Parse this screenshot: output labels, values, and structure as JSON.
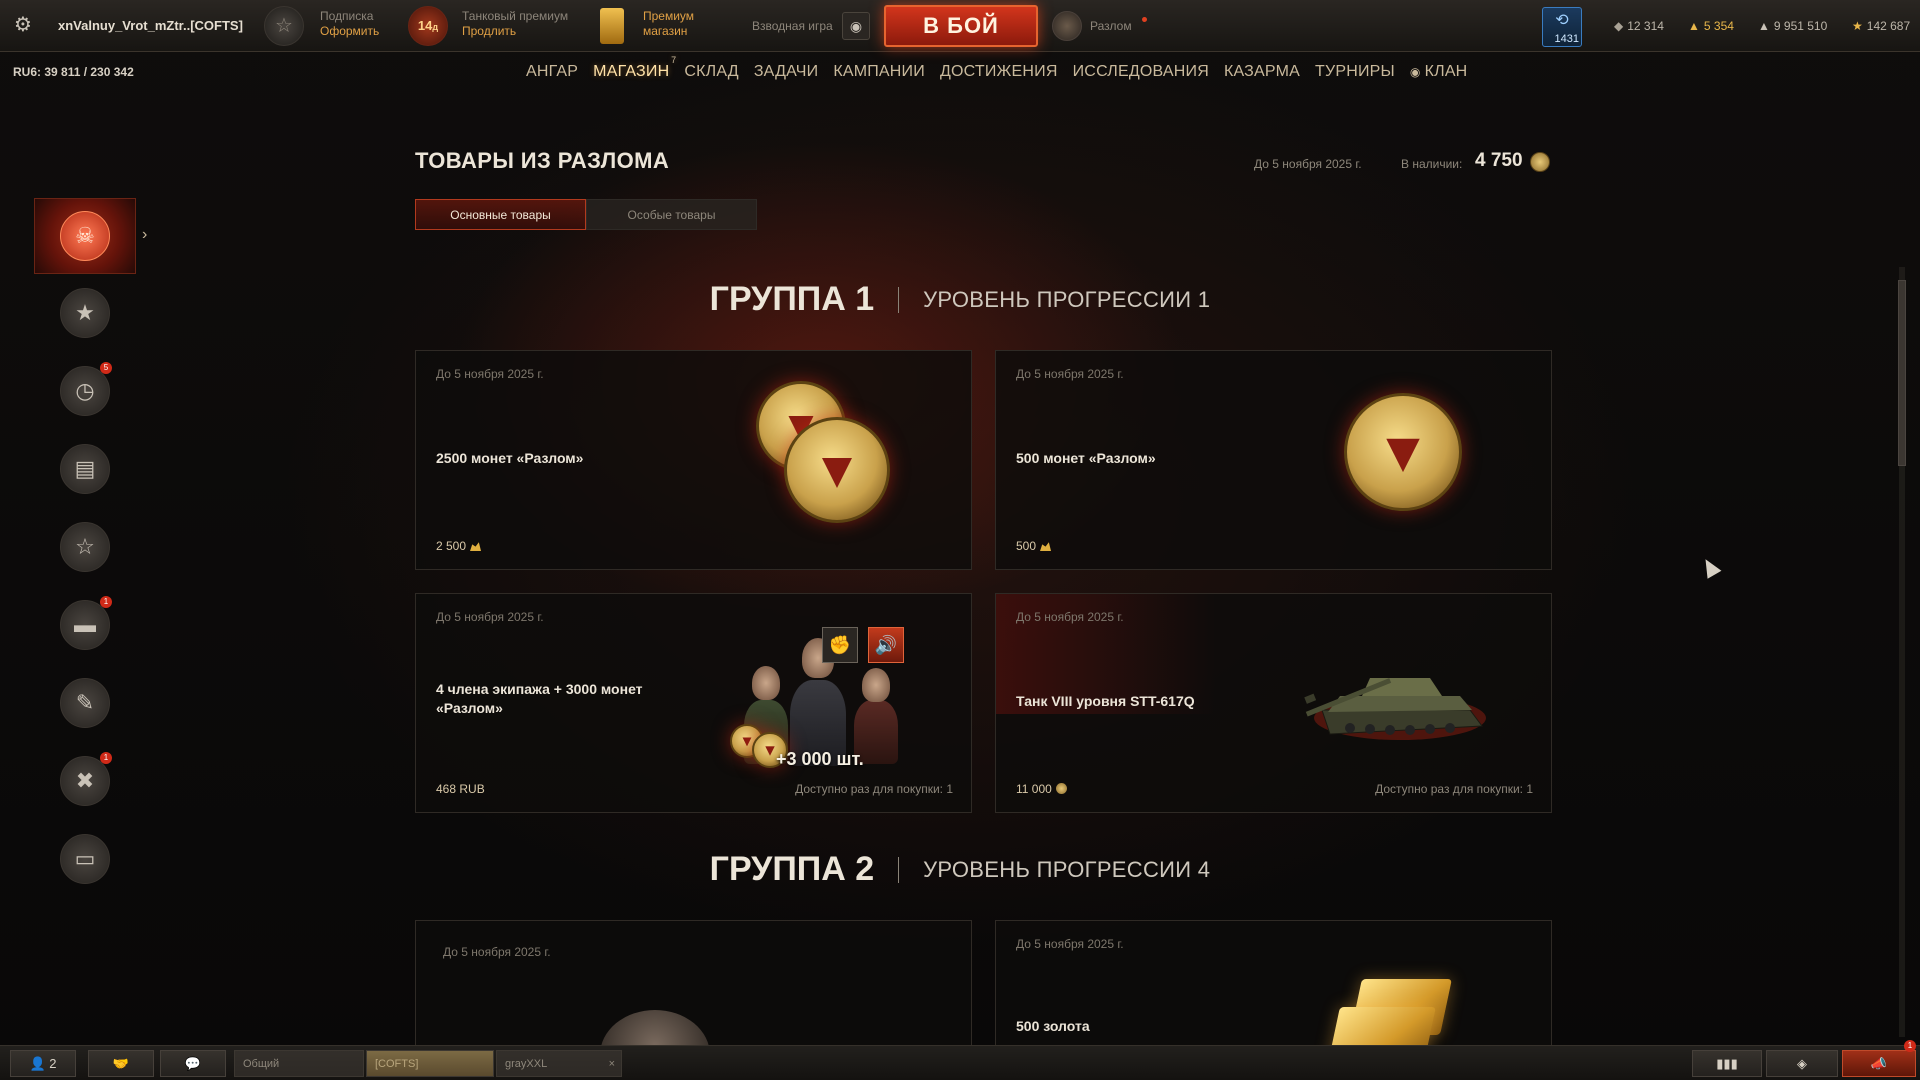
{
  "topbar": {
    "nickname": "xnValnuy_Vrot_mZtr..[COFTS]",
    "subscription": {
      "label": "Подписка",
      "action": "Оформить"
    },
    "tank_premium": {
      "days": "14",
      "days_unit": "д",
      "label": "Танковый премиум",
      "action": "Продлить"
    },
    "premium_shop": {
      "line1": "Премиум",
      "line2": "магазин"
    },
    "platoon_label": "Взводная игра",
    "battle_button": "В БОЙ",
    "mode_label": "Разлом",
    "level_badge": "1431",
    "currencies": [
      {
        "icon": "bond-icon",
        "value": "12 314"
      },
      {
        "icon": "gold-icon",
        "value": "5 354"
      },
      {
        "icon": "credits-icon",
        "value": "9 951 510"
      },
      {
        "icon": "free-xp-icon",
        "value": "142 687"
      }
    ]
  },
  "ru_line": "RU6: 39 811  /  230 342",
  "nav": {
    "items": [
      {
        "label": "АНГАР"
      },
      {
        "label": "МАГАЗИН",
        "badge": "7",
        "active": true
      },
      {
        "label": "СКЛАД"
      },
      {
        "label": "ЗАДАЧИ"
      },
      {
        "label": "КАМПАНИИ"
      },
      {
        "label": "ДОСТИЖЕНИЯ"
      },
      {
        "label": "ИССЛЕДОВАНИЯ"
      },
      {
        "label": "КАЗАРМА"
      },
      {
        "label": "ТУРНИРЫ"
      },
      {
        "label": "КЛАН"
      }
    ]
  },
  "sidebar": {
    "items": [
      {
        "icon": "rift-icon",
        "active": true
      },
      {
        "icon": "star-icon"
      },
      {
        "icon": "clock-icon",
        "badge": "5"
      },
      {
        "icon": "cards-icon"
      },
      {
        "icon": "star-badge-icon"
      },
      {
        "icon": "tank-icon",
        "badge": "1"
      },
      {
        "icon": "brush-icon"
      },
      {
        "icon": "tools-icon",
        "badge": "1"
      },
      {
        "icon": "money-icon"
      }
    ]
  },
  "page": {
    "title": "ТОВАРЫ ИЗ РАЗЛОМА",
    "deadline": "До 5 ноября 2025 г.",
    "available_label": "В наличии:",
    "available_value": "4 750",
    "tabs": [
      {
        "label": "Основные товары",
        "active": true
      },
      {
        "label": "Особые товары"
      }
    ]
  },
  "groups": [
    {
      "name": "ГРУППА 1",
      "level": "УРОВЕНЬ ПРОГРЕССИИ 1",
      "cards": [
        {
          "date": "До 5 ноября 2025 г.",
          "name": "2500 монет «Разлом»",
          "price": "2 500",
          "price_icon": "gold-icon"
        },
        {
          "date": "До 5 ноября 2025 г.",
          "name": "500 монет «Разлом»",
          "price": "500",
          "price_icon": "gold-icon"
        },
        {
          "date": "До 5 ноября 2025 г.",
          "name": "4 члена экипажа + 3000 монет «Разлом»",
          "price": "468 RUB",
          "limit": "Доступно раз для покупки: 1",
          "overlay": "+3 000 шт."
        },
        {
          "date": "До 5 ноября 2025 г.",
          "name": "Танк VIII уровня STT-617Q",
          "price": "11 000",
          "price_icon": "rift-coin-icon",
          "limit": "Доступно раз для покупки: 1"
        }
      ]
    },
    {
      "name": "ГРУППА 2",
      "level": "УРОВЕНЬ ПРОГРЕССИИ 4",
      "cards": [
        {
          "date": "До 5 ноября 2025 г."
        },
        {
          "date": "До 5 ноября 2025 г.",
          "name": "500 золота"
        }
      ]
    }
  ],
  "bottombar": {
    "players_count": "2",
    "channels": [
      {
        "label": "Общий"
      },
      {
        "label": "[COFTS]",
        "active": true
      },
      {
        "label": "grayXXL"
      }
    ],
    "alert_badge": "1"
  }
}
